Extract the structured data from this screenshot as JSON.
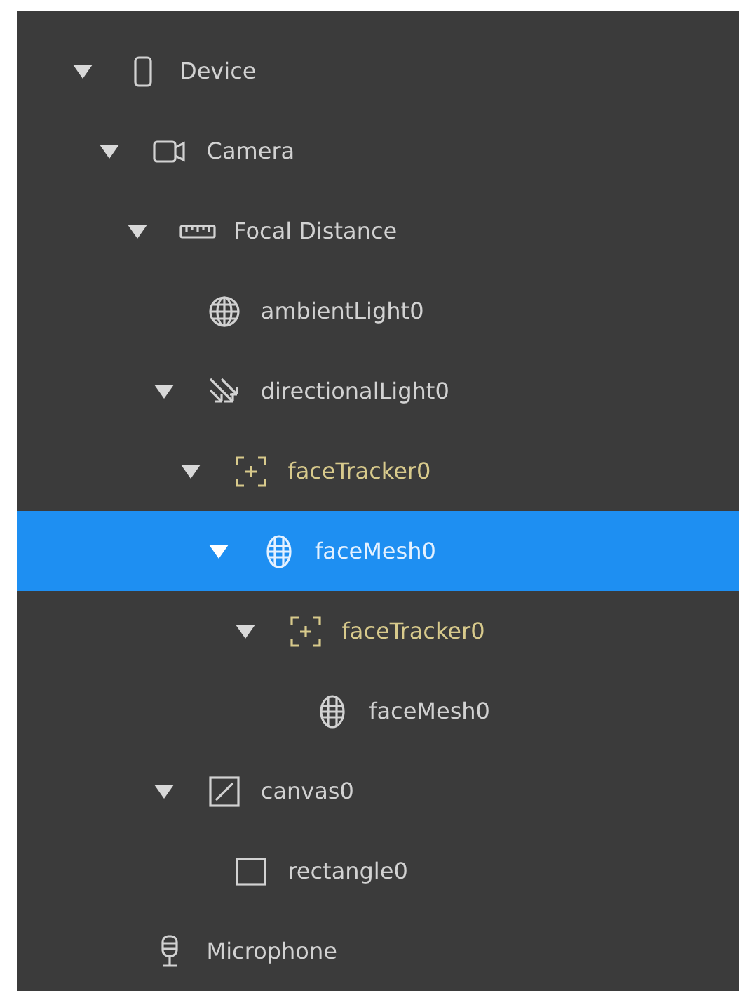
{
  "tree": [
    {
      "label": "Device",
      "kind": "device",
      "expanded": true,
      "selected": false,
      "children": [
        {
          "label": "Camera",
          "kind": "camera",
          "expanded": true,
          "selected": false,
          "children": [
            {
              "label": "Focal Distance",
              "kind": "ruler",
              "expanded": true,
              "selected": false,
              "children": [
                {
                  "label": "ambientLight0",
                  "kind": "globe",
                  "selected": false
                },
                {
                  "label": "directionalLight0",
                  "kind": "directional",
                  "expanded": true,
                  "selected": false,
                  "children": [
                    {
                      "label": "faceTracker0",
                      "kind": "tracker",
                      "expanded": true,
                      "selected": false,
                      "children": [
                        {
                          "label": "faceMesh0",
                          "kind": "mesh",
                          "expanded": true,
                          "selected": true,
                          "children": [
                            {
                              "label": "faceTracker0",
                              "kind": "tracker",
                              "expanded": true,
                              "selected": false,
                              "children": [
                                {
                                  "label": "faceMesh0",
                                  "kind": "mesh",
                                  "selected": false
                                }
                              ]
                            }
                          ]
                        }
                      ]
                    }
                  ]
                },
                {
                  "label": "canvas0",
                  "kind": "canvas",
                  "expanded": true,
                  "selected": false,
                  "children": [
                    {
                      "label": "rectangle0",
                      "kind": "rectangle",
                      "selected": false
                    }
                  ]
                }
              ]
            }
          ]
        },
        {
          "label": "Microphone",
          "kind": "microphone",
          "selected": false
        }
      ]
    }
  ]
}
